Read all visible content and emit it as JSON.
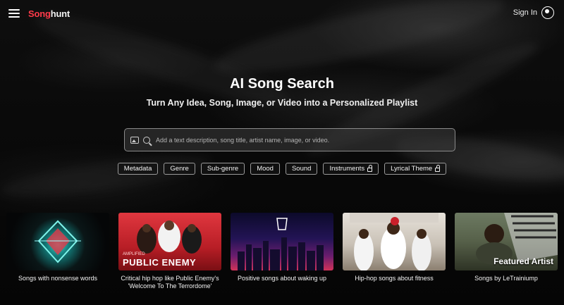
{
  "header": {
    "logo_part1": "Song",
    "logo_part2": "hunt",
    "sign_in": "Sign In",
    "colors": {
      "logo_accent": "#ff3b4a",
      "background": "#050505"
    },
    "icons": {
      "menu": "hamburger-icon",
      "sign_in": "user-circle-icon"
    }
  },
  "hero": {
    "title": "AI Song Search",
    "subtitle": "Turn Any Idea, Song, Image, or Video into a Personalized Playlist"
  },
  "search": {
    "placeholder": "Add a text description, song title, artist name, image, or video.",
    "value": "",
    "icons": [
      "image-icon",
      "search-icon"
    ]
  },
  "filters": [
    {
      "label": "Metadata",
      "locked": false
    },
    {
      "label": "Genre",
      "locked": false
    },
    {
      "label": "Sub-genre",
      "locked": false
    },
    {
      "label": "Mood",
      "locked": false
    },
    {
      "label": "Sound",
      "locked": false
    },
    {
      "label": "Instruments",
      "locked": true
    },
    {
      "label": "Lyrical Theme",
      "locked": true
    }
  ],
  "cards": [
    {
      "caption": "Songs with nonsense words",
      "overlay": ""
    },
    {
      "caption": "Critical hip hop like Public Enemy's 'Welcome To The Terrordome'",
      "overlay": "PUBLIC ENEMY",
      "overlay_small": "AMPLIFIED"
    },
    {
      "caption": "Positive songs about waking up",
      "overlay": ""
    },
    {
      "caption": "Hip-hop songs about fitness",
      "overlay": ""
    },
    {
      "caption": "Songs by LeTrainiump",
      "overlay": "Featured Artist"
    }
  ]
}
